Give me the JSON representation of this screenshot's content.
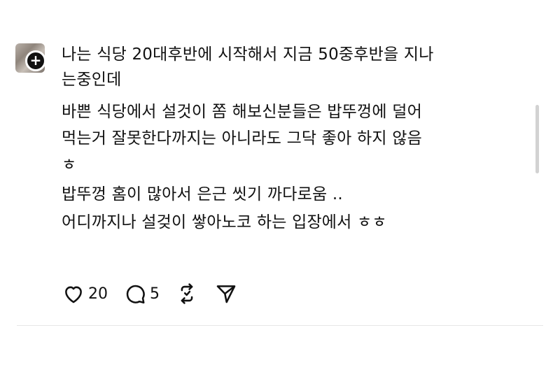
{
  "post": {
    "lines": [
      "나는 식당 20대후반에 시작해서 지금 50중후반을 지나",
      "는중인데",
      "바쁜 식당에서 설것이 쫌 해보신분들은 밥뚜껑에 덜어",
      "먹는거  잘못한다까지는 아니라도 그닥 좋아 하지 않음",
      "ㅎ",
      "밥뚜껑 홈이 많아서 은근 씻기 까다로움 ..",
      "어디까지나 설겆이 쌓아노코 하는 입장에서  ㅎㅎ"
    ]
  },
  "actions": {
    "like_count": "20",
    "reply_count": "5"
  },
  "icons": {
    "like": "heart-icon",
    "reply": "comment-bubble-icon",
    "repost": "repost-icon",
    "share": "send-icon",
    "follow": "plus-icon"
  }
}
